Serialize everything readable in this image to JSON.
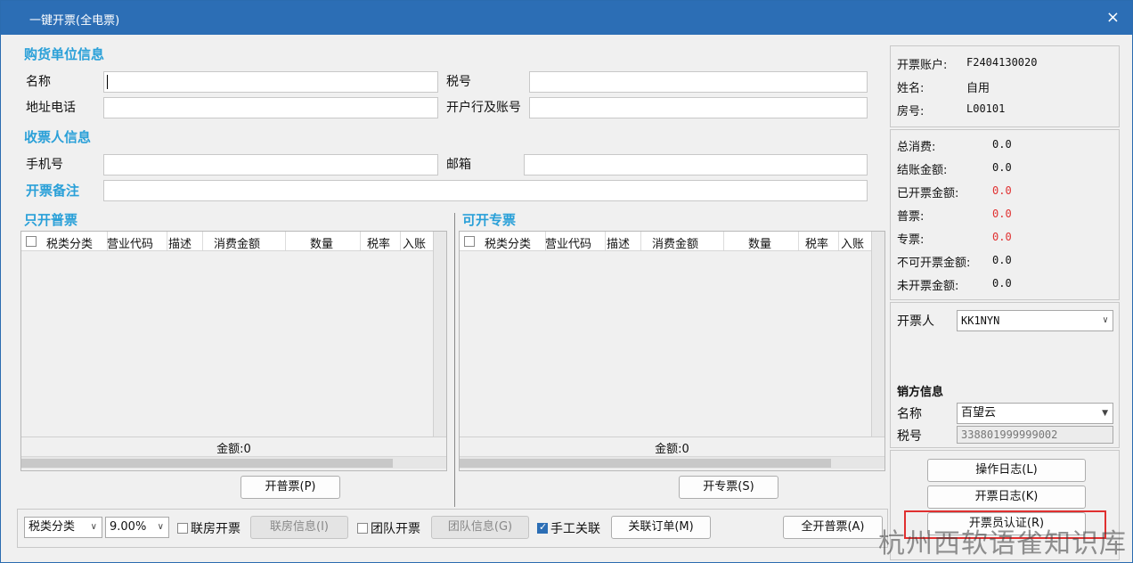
{
  "window": {
    "title": "一键开票(全电票)",
    "close": "×"
  },
  "buyer": {
    "section": "购货单位信息",
    "name_label": "名称",
    "name_value": "",
    "tax_label": "税号",
    "tax_value": "",
    "addr_label": "地址电话",
    "addr_value": "",
    "bank_label": "开户行及账号",
    "bank_value": ""
  },
  "receiver": {
    "section": "收票人信息",
    "phone_label": "手机号",
    "phone_value": "",
    "email_label": "邮箱",
    "email_value": "",
    "remark_label": "开票备注",
    "remark_value": ""
  },
  "grid_normal": {
    "title": "只开普票",
    "columns": [
      "税类分类",
      "营业代码",
      "描述",
      "消费金额",
      "数量",
      "税率",
      "入账"
    ],
    "total_label": "金额:0",
    "button": "开普票(P)"
  },
  "grid_special": {
    "title": "可开专票",
    "columns": [
      "税类分类",
      "营业代码",
      "描述",
      "消费金额",
      "数量",
      "税率",
      "入账"
    ],
    "total_label": "金额:0",
    "button": "开专票(S)"
  },
  "account": {
    "account_label": "开票账户:",
    "account_value": "F2404130020",
    "name_label": "姓名:",
    "name_value": "自用",
    "room_label": "房号:",
    "room_value": "L00101"
  },
  "amounts": {
    "total_label": "总消费:",
    "total_value": "0.0",
    "settle_label": "结账金额:",
    "settle_value": "0.0",
    "invoiced_label": "已开票金额:",
    "invoiced_value": "0.0",
    "normal_label": "普票:",
    "normal_value": "0.0",
    "special_label": "专票:",
    "special_value": "0.0",
    "noinv_label": "不可开票金额:",
    "noinv_value": "0.0",
    "uninv_label": "未开票金额:",
    "uninv_value": "0.0"
  },
  "issuer": {
    "label": "开票人",
    "value": "KK1NYN"
  },
  "seller": {
    "section": "销方信息",
    "name_label": "名称",
    "name_value": "百望云",
    "tax_label": "税号",
    "tax_value": "338801999999002"
  },
  "side_buttons": {
    "op_log": "操作日志(L)",
    "inv_log": "开票日志(K)",
    "auth": "开票员认证(R)"
  },
  "bottom": {
    "tax_class": "税类分类",
    "tax_rate": "9.00%",
    "room_invoice_label": "联房开票",
    "room_info_btn": "联房信息(I)",
    "group_invoice_label": "团队开票",
    "group_info_btn": "团队信息(G)",
    "manual_link_label": "手工关联",
    "link_order_btn": "关联订单(M)",
    "all_normal_btn": "全开普票(A)"
  },
  "watermark": "杭州西软语雀知识库",
  "colors": {
    "titlebar": "#2c6eb5",
    "section": "#2aa0d8",
    "red": "#e03030"
  }
}
